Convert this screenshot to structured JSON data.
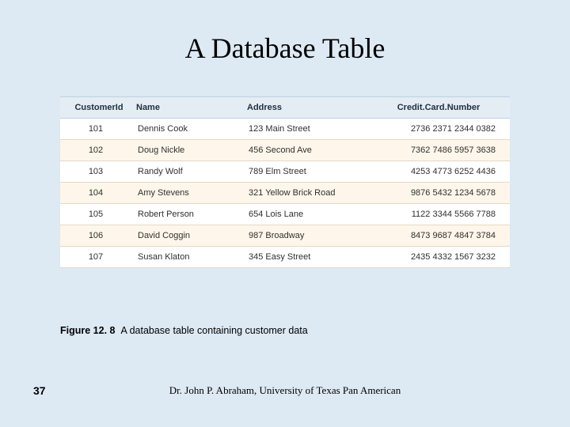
{
  "title": "A Database Table",
  "table": {
    "headers": {
      "id": "CustomerId",
      "name": "Name",
      "addr": "Address",
      "cc": "Credit.Card.Number"
    },
    "rows": [
      {
        "id": "101",
        "name": "Dennis Cook",
        "addr": "123 Main Street",
        "cc": "2736 2371 2344 0382"
      },
      {
        "id": "102",
        "name": "Doug Nickle",
        "addr": "456 Second Ave",
        "cc": "7362 7486 5957 3638"
      },
      {
        "id": "103",
        "name": "Randy Wolf",
        "addr": "789 Elm Street",
        "cc": "4253 4773 6252 4436"
      },
      {
        "id": "104",
        "name": "Amy Stevens",
        "addr": "321 Yellow Brick Road",
        "cc": "9876 5432 1234 5678"
      },
      {
        "id": "105",
        "name": "Robert Person",
        "addr": "654 Lois Lane",
        "cc": "1122 3344 5566 7788"
      },
      {
        "id": "106",
        "name": "David Coggin",
        "addr": "987 Broadway",
        "cc": "8473 9687 4847 3784"
      },
      {
        "id": "107",
        "name": "Susan Klaton",
        "addr": "345 Easy Street",
        "cc": "2435 4332 1567 3232"
      }
    ]
  },
  "caption": {
    "label": "Figure 12. 8",
    "text": "A database table containing customer data"
  },
  "page_number": "37",
  "footer": "Dr. John P. Abraham, University of Texas Pan American"
}
